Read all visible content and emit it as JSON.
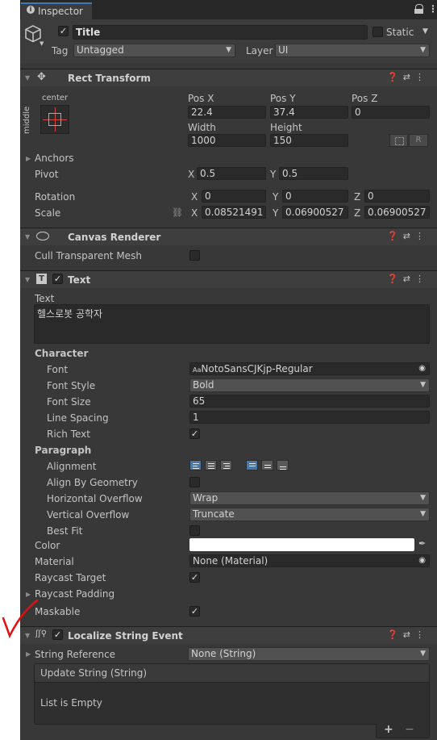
{
  "window": {
    "tab_label": "Inspector"
  },
  "gameobject": {
    "name": "Title",
    "static_label": "Static",
    "tag_label": "Tag",
    "tag_value": "Untagged",
    "layer_label": "Layer",
    "layer_value": "UI"
  },
  "rect_transform": {
    "title": "Rect Transform",
    "anchor_h": "center",
    "anchor_v": "middle",
    "pos_x_label": "Pos X",
    "pos_x": "22.4",
    "pos_y_label": "Pos Y",
    "pos_y": "37.4",
    "pos_z_label": "Pos Z",
    "pos_z": "0",
    "width_label": "Width",
    "width": "1000",
    "height_label": "Height",
    "height": "150",
    "r_button": "R",
    "anchors_label": "Anchors",
    "pivot_label": "Pivot",
    "pivot_x": "0.5",
    "pivot_y": "0.5",
    "rotation_label": "Rotation",
    "rot_x": "0",
    "rot_y": "0",
    "rot_z": "0",
    "scale_label": "Scale",
    "scale_x": "0.08521491",
    "scale_y": "0.06900527",
    "scale_z": "0.06900527",
    "x": "X",
    "y": "Y",
    "z": "Z"
  },
  "canvas_renderer": {
    "title": "Canvas Renderer",
    "cull_label": "Cull Transparent Mesh"
  },
  "text_component": {
    "title": "Text",
    "text_label": "Text",
    "text_value": "헬스로봇 공학자",
    "character_label": "Character",
    "font_label": "Font",
    "font_value": "NotoSansCJKjp-Regular",
    "font_prefix": "Aa",
    "font_style_label": "Font Style",
    "font_style_value": "Bold",
    "font_size_label": "Font Size",
    "font_size_value": "65",
    "line_spacing_label": "Line Spacing",
    "line_spacing_value": "1",
    "rich_text_label": "Rich Text",
    "paragraph_label": "Paragraph",
    "alignment_label": "Alignment",
    "align_geometry_label": "Align By Geometry",
    "h_overflow_label": "Horizontal Overflow",
    "h_overflow_value": "Wrap",
    "v_overflow_label": "Vertical Overflow",
    "v_overflow_value": "Truncate",
    "best_fit_label": "Best Fit",
    "color_label": "Color",
    "color_value": "#ffffff",
    "material_label": "Material",
    "material_value": "None (Material)",
    "raycast_target_label": "Raycast Target",
    "raycast_padding_label": "Raycast Padding",
    "maskable_label": "Maskable"
  },
  "localize": {
    "title": "Localize String Event",
    "string_ref_label": "String Reference",
    "string_ref_value": "None (String)",
    "event_title": "Update String (String)",
    "empty_label": "List is Empty",
    "add": "+",
    "remove": "−"
  },
  "colors": {
    "panel": "#383838",
    "header": "#3e3e3e",
    "accent": "#4b77a8",
    "annotation": "#e01010"
  }
}
